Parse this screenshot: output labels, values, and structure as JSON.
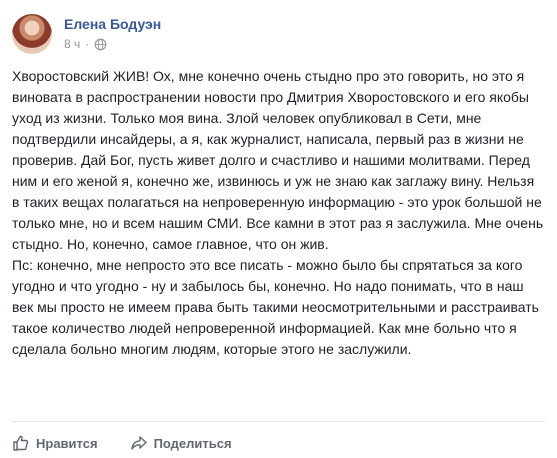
{
  "post": {
    "author": "Елена Бодуэн",
    "time": "8 ч",
    "privacy_icon": "globe-icon",
    "paragraphs": [
      "Хворостовский ЖИВ! Ох, мне конечно очень стыдно про это говорить, но это я виновата в распространении новости про Дмитрия Хворостовского и его якобы уход из жизни. Только моя вина. Злой человек опубликовал в Сети, мне подтвердили инсайдеры, а я, как журналист, написала, первый раз в жизни не проверив. Дай Бог, пусть живет долго и счастливо и нашими молитвами. Перед ним и его женой я, конечно же, извинюсь и уж не знаю как заглажу вину. Нельзя в таких вещах полагаться на непроверенную информацию - это урок большой не только мне, но и всем нашим СМИ. Все камни в этот раз я заслужила. Мне очень стыдно. Но, конечно, самое главное, что он жив.",
      "Пс: конечно, мне непросто это все писать - можно было бы спрятаться за кого угодно и что угодно - ну и забылось бы, конечно. Но надо понимать, что в наш век мы просто не имеем права быть такими неосмотрительными и расстраивать такое количество людей непроверенной информацией. Как мне больно что я сделала больно многим людям, которые этого не заслужили."
    ]
  },
  "actions": {
    "like_label": "Нравится",
    "like_icon": "thumbs-up-icon",
    "share_label": "Поделиться",
    "share_icon": "share-arrow-icon"
  },
  "colors": {
    "author_link": "#365899",
    "text": "#1d2129",
    "meta": "#90949c",
    "action": "#606770"
  }
}
